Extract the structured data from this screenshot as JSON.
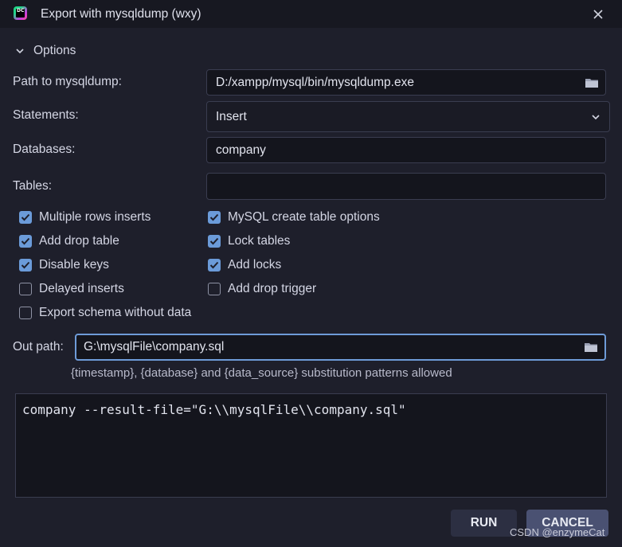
{
  "window": {
    "title": "Export with mysqldump (wxy)",
    "logo_text": "DC"
  },
  "options": {
    "header": "Options",
    "path_label": "Path to mysqldump:",
    "path_value": "D:/xampp/mysql/bin/mysqldump.exe",
    "statements_label": "Statements:",
    "statements_value": "Insert",
    "databases_label": "Databases:",
    "databases_value": "company",
    "tables_label": "Tables:",
    "tables_value": ""
  },
  "checkboxes": [
    {
      "label": "Multiple rows inserts",
      "checked": true
    },
    {
      "label": "MySQL create table options",
      "checked": true
    },
    {
      "label": "Add drop table",
      "checked": true
    },
    {
      "label": "Lock tables",
      "checked": true
    },
    {
      "label": "Disable keys",
      "checked": true
    },
    {
      "label": "Add locks",
      "checked": true
    },
    {
      "label": "Delayed inserts",
      "checked": false
    },
    {
      "label": "Add drop trigger",
      "checked": false
    },
    {
      "label": "Export schema without data",
      "checked": false
    }
  ],
  "out": {
    "label": "Out path:",
    "value": "G:\\mysqlFile\\company.sql",
    "hint": "{timestamp}, {database} and {data_source} substitution patterns allowed"
  },
  "command": "company --result-file=\"G:\\\\mysqlFile\\\\company.sql\"",
  "buttons": {
    "run": "RUN",
    "cancel": "CANCEL"
  },
  "watermark": "CSDN @enzymeCat",
  "colors": {
    "background": "#1e1f2b",
    "titlebar": "#171821",
    "checkbox_accent": "#6b9bd9",
    "focus_border": "#6e9bd8"
  }
}
